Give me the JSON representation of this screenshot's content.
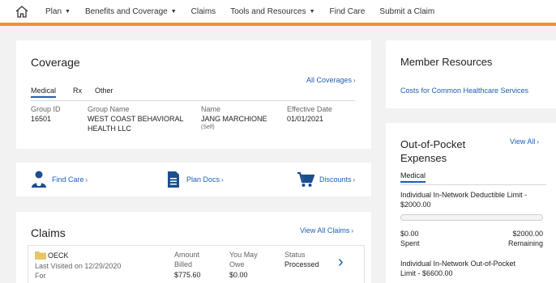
{
  "nav": {
    "items": [
      {
        "label": "Plan",
        "dropdown": true
      },
      {
        "label": "Benefits and Coverage",
        "dropdown": true
      },
      {
        "label": "Claims",
        "dropdown": false
      },
      {
        "label": "Tools and Resources",
        "dropdown": true
      },
      {
        "label": "Find Care",
        "dropdown": false
      },
      {
        "label": "Submit a Claim",
        "dropdown": false
      }
    ]
  },
  "coverage": {
    "title": "Coverage",
    "all_link": "All Coverages",
    "tabs": [
      "Medical",
      "Rx",
      "Other"
    ],
    "group_id_label": "Group ID",
    "group_id": "16501",
    "group_name_label": "Group Name",
    "group_name_line1": "WEST COAST BEHAVIORAL",
    "group_name_line2": "HEALTH LLC",
    "name_label": "Name",
    "name": "JANG MARCHIONE",
    "relation": "(Self)",
    "effective_label": "Effective Date",
    "effective_date": "01/01/2021"
  },
  "quick_links": {
    "find_care": "Find Care",
    "plan_docs": "Plan Docs",
    "discounts": "Discounts"
  },
  "claims": {
    "title": "Claims",
    "view_all": "View All Claims",
    "item": {
      "name": "OECK",
      "last_visited": "Last Visited on 12/29/2020",
      "for_label": "For",
      "amount_label1": "Amount",
      "amount_label2": "Billed",
      "amount": "$775.60",
      "owe_label1": "You May",
      "owe_label2": "Owe",
      "owe": "$0.00",
      "status_label": "Status",
      "status": "Processed"
    }
  },
  "member_resources": {
    "title": "Member Resources",
    "link": "Costs for Common Healthcare Services"
  },
  "oop": {
    "title_line1": "Out-of-Pocket",
    "title_line2": "Expenses",
    "view_all": "View All",
    "tab": "Medical",
    "deductible_label": "Individual In-Network Deductible Limit -",
    "deductible_amount": "$2000.00",
    "deductible_progress": 0,
    "spent": "$0.00",
    "spent_label": "Spent",
    "remaining": "$2000.00",
    "remaining_label": "Remaining",
    "oop_label": "Individual In-Network Out-of-Pocket",
    "oop_amount": "Limit - $6600.00"
  },
  "colors": {
    "accent": "#f0922b",
    "link": "#1f5fb0",
    "icon": "#1b4f8f",
    "folder": "#e9c46a"
  }
}
